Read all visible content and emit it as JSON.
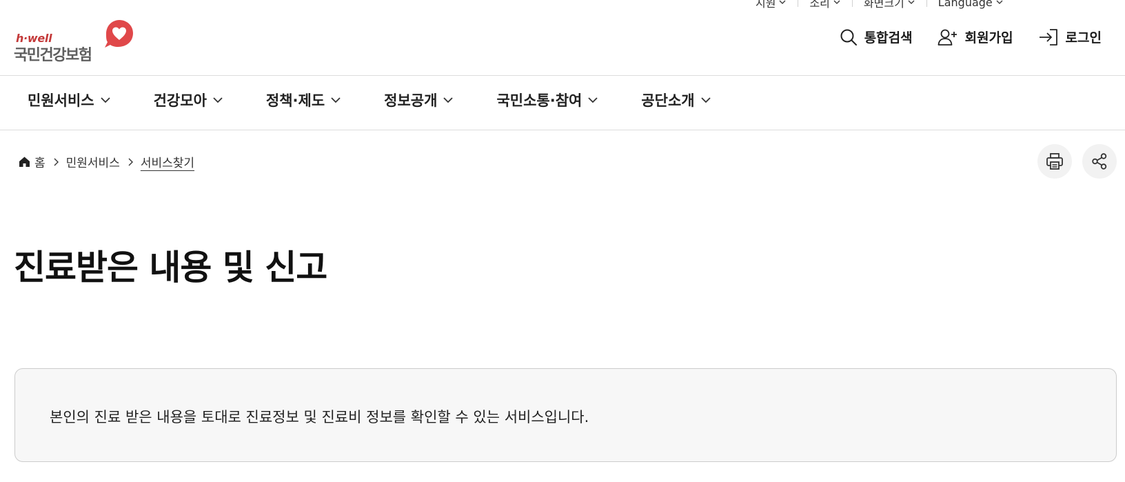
{
  "utility_bar": {
    "items": [
      {
        "label": "지원"
      },
      {
        "label": "소리"
      },
      {
        "label": "화면크기"
      },
      {
        "label": "Language"
      }
    ]
  },
  "logo": {
    "brand": "h·well",
    "name": "국민건강보험",
    "brand_color": "#c43b3b",
    "heart_color": "#e0484a"
  },
  "header_actions": {
    "search": {
      "label": "통합검색",
      "icon": "search-icon"
    },
    "signup": {
      "label": "회원가입",
      "icon": "user-plus-icon"
    },
    "login": {
      "label": "로그인",
      "icon": "login-icon"
    }
  },
  "main_nav": {
    "items": [
      {
        "label": "민원서비스"
      },
      {
        "label": "건강모아"
      },
      {
        "label": "정책·제도"
      },
      {
        "label": "정보공개"
      },
      {
        "label": "국민소통·참여"
      },
      {
        "label": "공단소개"
      }
    ]
  },
  "breadcrumb": {
    "home": "홈",
    "items": [
      "민원서비스",
      "서비스찾기"
    ]
  },
  "tools": {
    "print_icon": "printer-icon",
    "share_icon": "share-icon"
  },
  "page": {
    "title": "진료받은 내용 및 신고",
    "description": "본인의 진료 받은 내용을 토대로 진료정보 및 진료비 정보를 확인할 수 있는 서비스입니다."
  }
}
